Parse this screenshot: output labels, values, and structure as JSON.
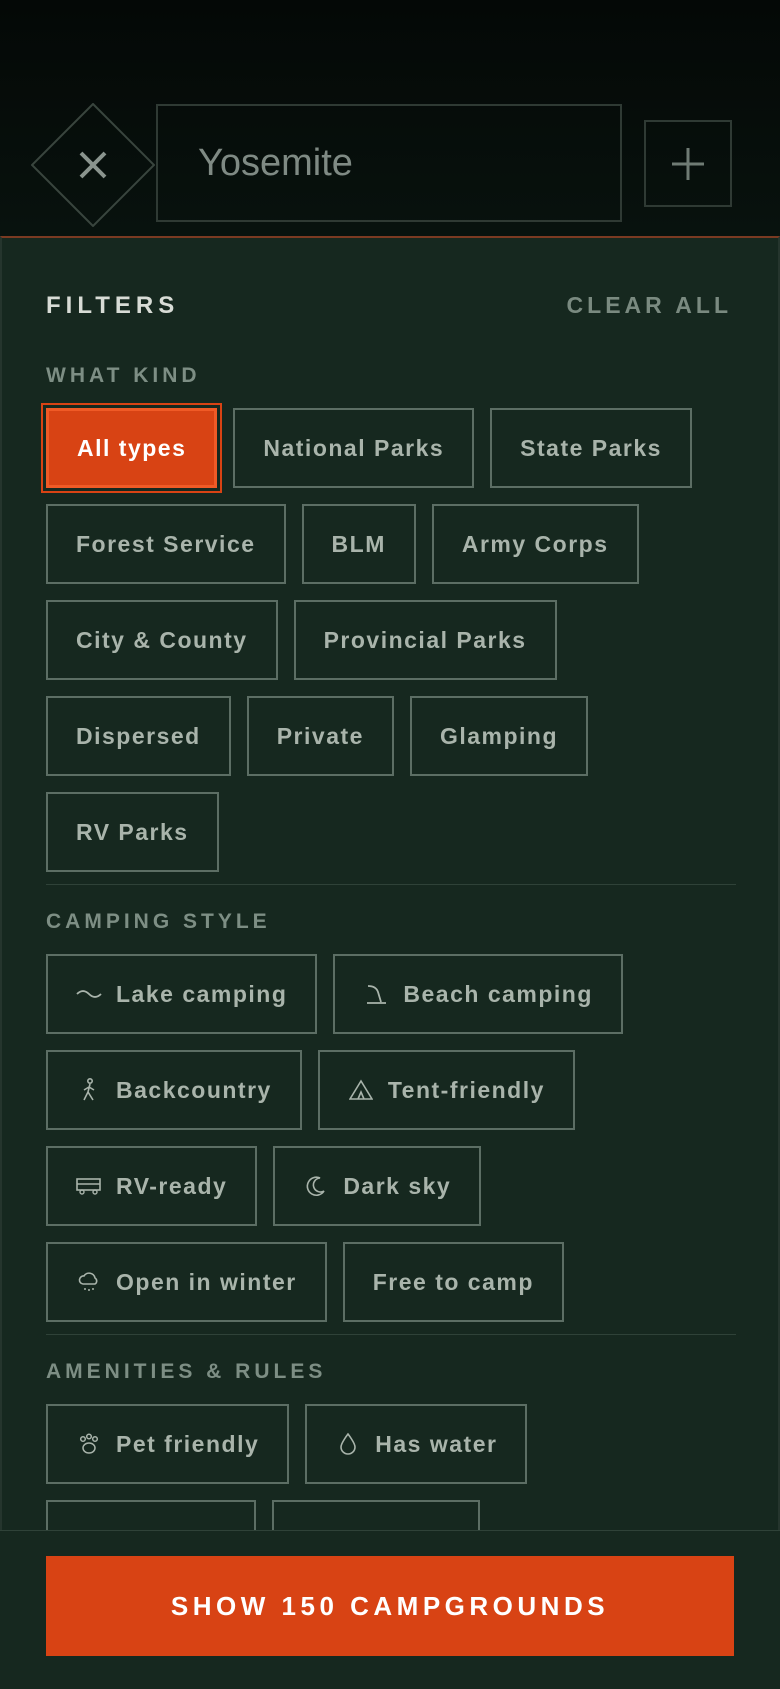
{
  "search": {
    "value": "Yosemite"
  },
  "panel": {
    "title": "FILTERS",
    "clear_all": "CLEAR ALL"
  },
  "what_kind": {
    "label": "WHAT KIND",
    "options": [
      {
        "label": "All types",
        "selected": true
      },
      {
        "label": "National Parks",
        "selected": false
      },
      {
        "label": "State Parks",
        "selected": false
      },
      {
        "label": "Forest Service",
        "selected": false
      },
      {
        "label": "BLM",
        "selected": false
      },
      {
        "label": "Army Corps",
        "selected": false
      },
      {
        "label": "City & County",
        "selected": false
      },
      {
        "label": "Provincial Parks",
        "selected": false
      },
      {
        "label": "Dispersed",
        "selected": false
      },
      {
        "label": "Private",
        "selected": false
      },
      {
        "label": "Glamping",
        "selected": false
      },
      {
        "label": "RV Parks",
        "selected": false
      }
    ]
  },
  "camping_style": {
    "label": "CAMPING STYLE",
    "options": [
      {
        "label": "Lake camping",
        "icon": "wave-icon"
      },
      {
        "label": "Beach camping",
        "icon": "beach-icon"
      },
      {
        "label": "Backcountry",
        "icon": "hiker-icon"
      },
      {
        "label": "Tent-friendly",
        "icon": "tent-icon"
      },
      {
        "label": "RV-ready",
        "icon": "rv-icon"
      },
      {
        "label": "Dark sky",
        "icon": "moon-icon"
      },
      {
        "label": "Open in winter",
        "icon": "snow-cloud-icon"
      },
      {
        "label": "Free to camp",
        "icon": ""
      }
    ]
  },
  "amenities": {
    "label": "AMENITIES & RULES",
    "options": [
      {
        "label": "Pet friendly",
        "icon": "paw-icon"
      },
      {
        "label": "Has water",
        "icon": "water-drop-icon"
      }
    ]
  },
  "cta": {
    "label": "SHOW 150 CAMPGROUNDS"
  },
  "colors": {
    "accent": "#d84314",
    "panel_bg": "#16281f",
    "header_bg": "#050a08"
  }
}
